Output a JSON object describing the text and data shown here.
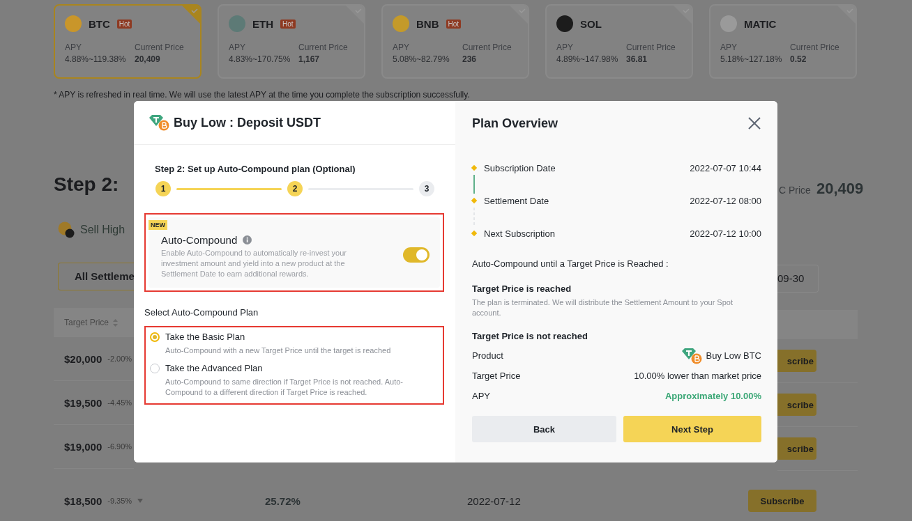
{
  "coins": [
    {
      "symbol": "BTC",
      "badge": "Hot",
      "color": "#c9962a",
      "selected": true,
      "apy_label": "APY",
      "apy": "4.88%~119.38%",
      "price_label": "Current Price",
      "price": "20,409"
    },
    {
      "symbol": "ETH",
      "badge": "Hot",
      "color": "#5d7a76",
      "selected": false,
      "apy_label": "APY",
      "apy": "4.83%~170.75%",
      "price_label": "Current Price",
      "price": "1,167"
    },
    {
      "symbol": "BNB",
      "badge": "Hot",
      "color": "#c49a2a",
      "selected": false,
      "apy_label": "APY",
      "apy": "5.08%~82.79%",
      "price_label": "Current Price",
      "price": "236"
    },
    {
      "symbol": "SOL",
      "color": "#1c1c1c",
      "selected": false,
      "apy_label": "APY",
      "apy": "4.89%~147.98%",
      "price_label": "Current Price",
      "price": "36.81"
    },
    {
      "symbol": "MATIC",
      "color": "#9a9a9a",
      "selected": false,
      "apy_label": "APY",
      "apy": "5.18%~127.18%",
      "price_label": "Current Price",
      "price": "0.52"
    }
  ],
  "note": "* APY is refreshed in real time. We will use the latest APY at the time you complete the subscription successfully.",
  "background": {
    "heading": "Step 2:",
    "price_label": "C Price",
    "price": "20,409",
    "tab": "Sell High",
    "filter": "All Settleme",
    "filter_end": "09-30",
    "table_header": "Target Price",
    "rows": [
      {
        "price": "$20,000",
        "change": "-2.00%",
        "action": "scribe"
      },
      {
        "price": "$19,500",
        "change": "-4.45%",
        "action": "scribe"
      },
      {
        "price": "$19,000",
        "change": "-6.90%",
        "action": "scribe"
      }
    ],
    "last_row": {
      "price": "$18,500",
      "change": "-9.35%",
      "apy": "25.72%",
      "date": "2022-07-12",
      "action": "Subscribe"
    }
  },
  "modal": {
    "title": "Buy Low : Deposit USDT",
    "step_title": "Step 2: Set up Auto-Compound plan (Optional)",
    "steps": [
      {
        "label": "1",
        "reached": true
      },
      {
        "label": "2",
        "reached": true
      },
      {
        "label": "3",
        "reached": false
      }
    ],
    "auto_compound": {
      "badge": "NEW",
      "title": "Auto-Compound",
      "description": "Enable Auto-Compound to automatically re-invest your investment amount and yield into a new product at the Settlement Date to earn additional rewards.",
      "on": true
    },
    "plan_heading": "Select Auto-Compound Plan",
    "plans": [
      {
        "title": "Take the Basic Plan",
        "description": "Auto-Compound with a new Target Price until the target is reached",
        "selected": true
      },
      {
        "title": "Take the Advanced Plan",
        "description": "Auto-Compound to same direction if Target Price is not reached. Auto-Compound to a different direction if Target Price is reached.",
        "selected": false
      }
    ],
    "overview": {
      "title": "Plan Overview",
      "timeline": [
        {
          "label": "Subscription Date",
          "value": "2022-07-07 10:44",
          "passed": true
        },
        {
          "label": "Settlement Date",
          "value": "2022-07-12 08:00",
          "passed": false
        },
        {
          "label": "Next Subscription",
          "value": "2022-07-12 10:00"
        }
      ],
      "rule": "Auto-Compound until a Target Price is Reached :",
      "reached_title": "Target Price is reached",
      "reached_text": "The plan is terminated. We will distribute the Settlement Amount to your Spot account.",
      "not_reached_title": "Target Price is not reached",
      "details": [
        {
          "label": "Product",
          "value": "Buy Low BTC",
          "kind": "product"
        },
        {
          "label": "Target Price",
          "value": "10.00% lower than market price",
          "kind": "text"
        },
        {
          "label": "APY",
          "value": "Approximately 10.00%",
          "kind": "highlight"
        }
      ]
    },
    "buttons": [
      {
        "label": "Back",
        "kind": "secondary"
      },
      {
        "label": "Next Step",
        "kind": "primary"
      }
    ]
  }
}
